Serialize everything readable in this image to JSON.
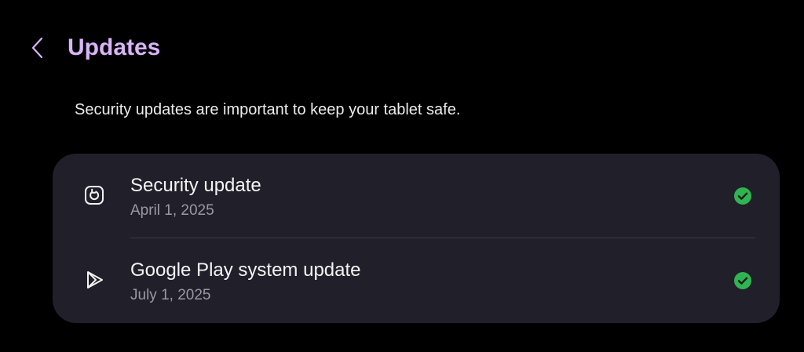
{
  "header": {
    "back_icon": "chevron-left-icon",
    "title": "Updates"
  },
  "description": "Security updates are important to keep your tablet safe.",
  "updates": [
    {
      "title": "Security update",
      "date": "April 1, 2025",
      "icon": "security-refresh-icon",
      "status_icon": "check-circle-icon"
    },
    {
      "title": "Google Play system update",
      "date": "July 1, 2025",
      "icon": "google-play-icon",
      "status_icon": "check-circle-icon"
    }
  ],
  "colors": {
    "background": "#000000",
    "title_accent": "#d8b4f8",
    "card_background": "#211f29",
    "primary_text": "#f4f4f4",
    "secondary_text": "#9a98a3",
    "success": "#2fb451"
  }
}
